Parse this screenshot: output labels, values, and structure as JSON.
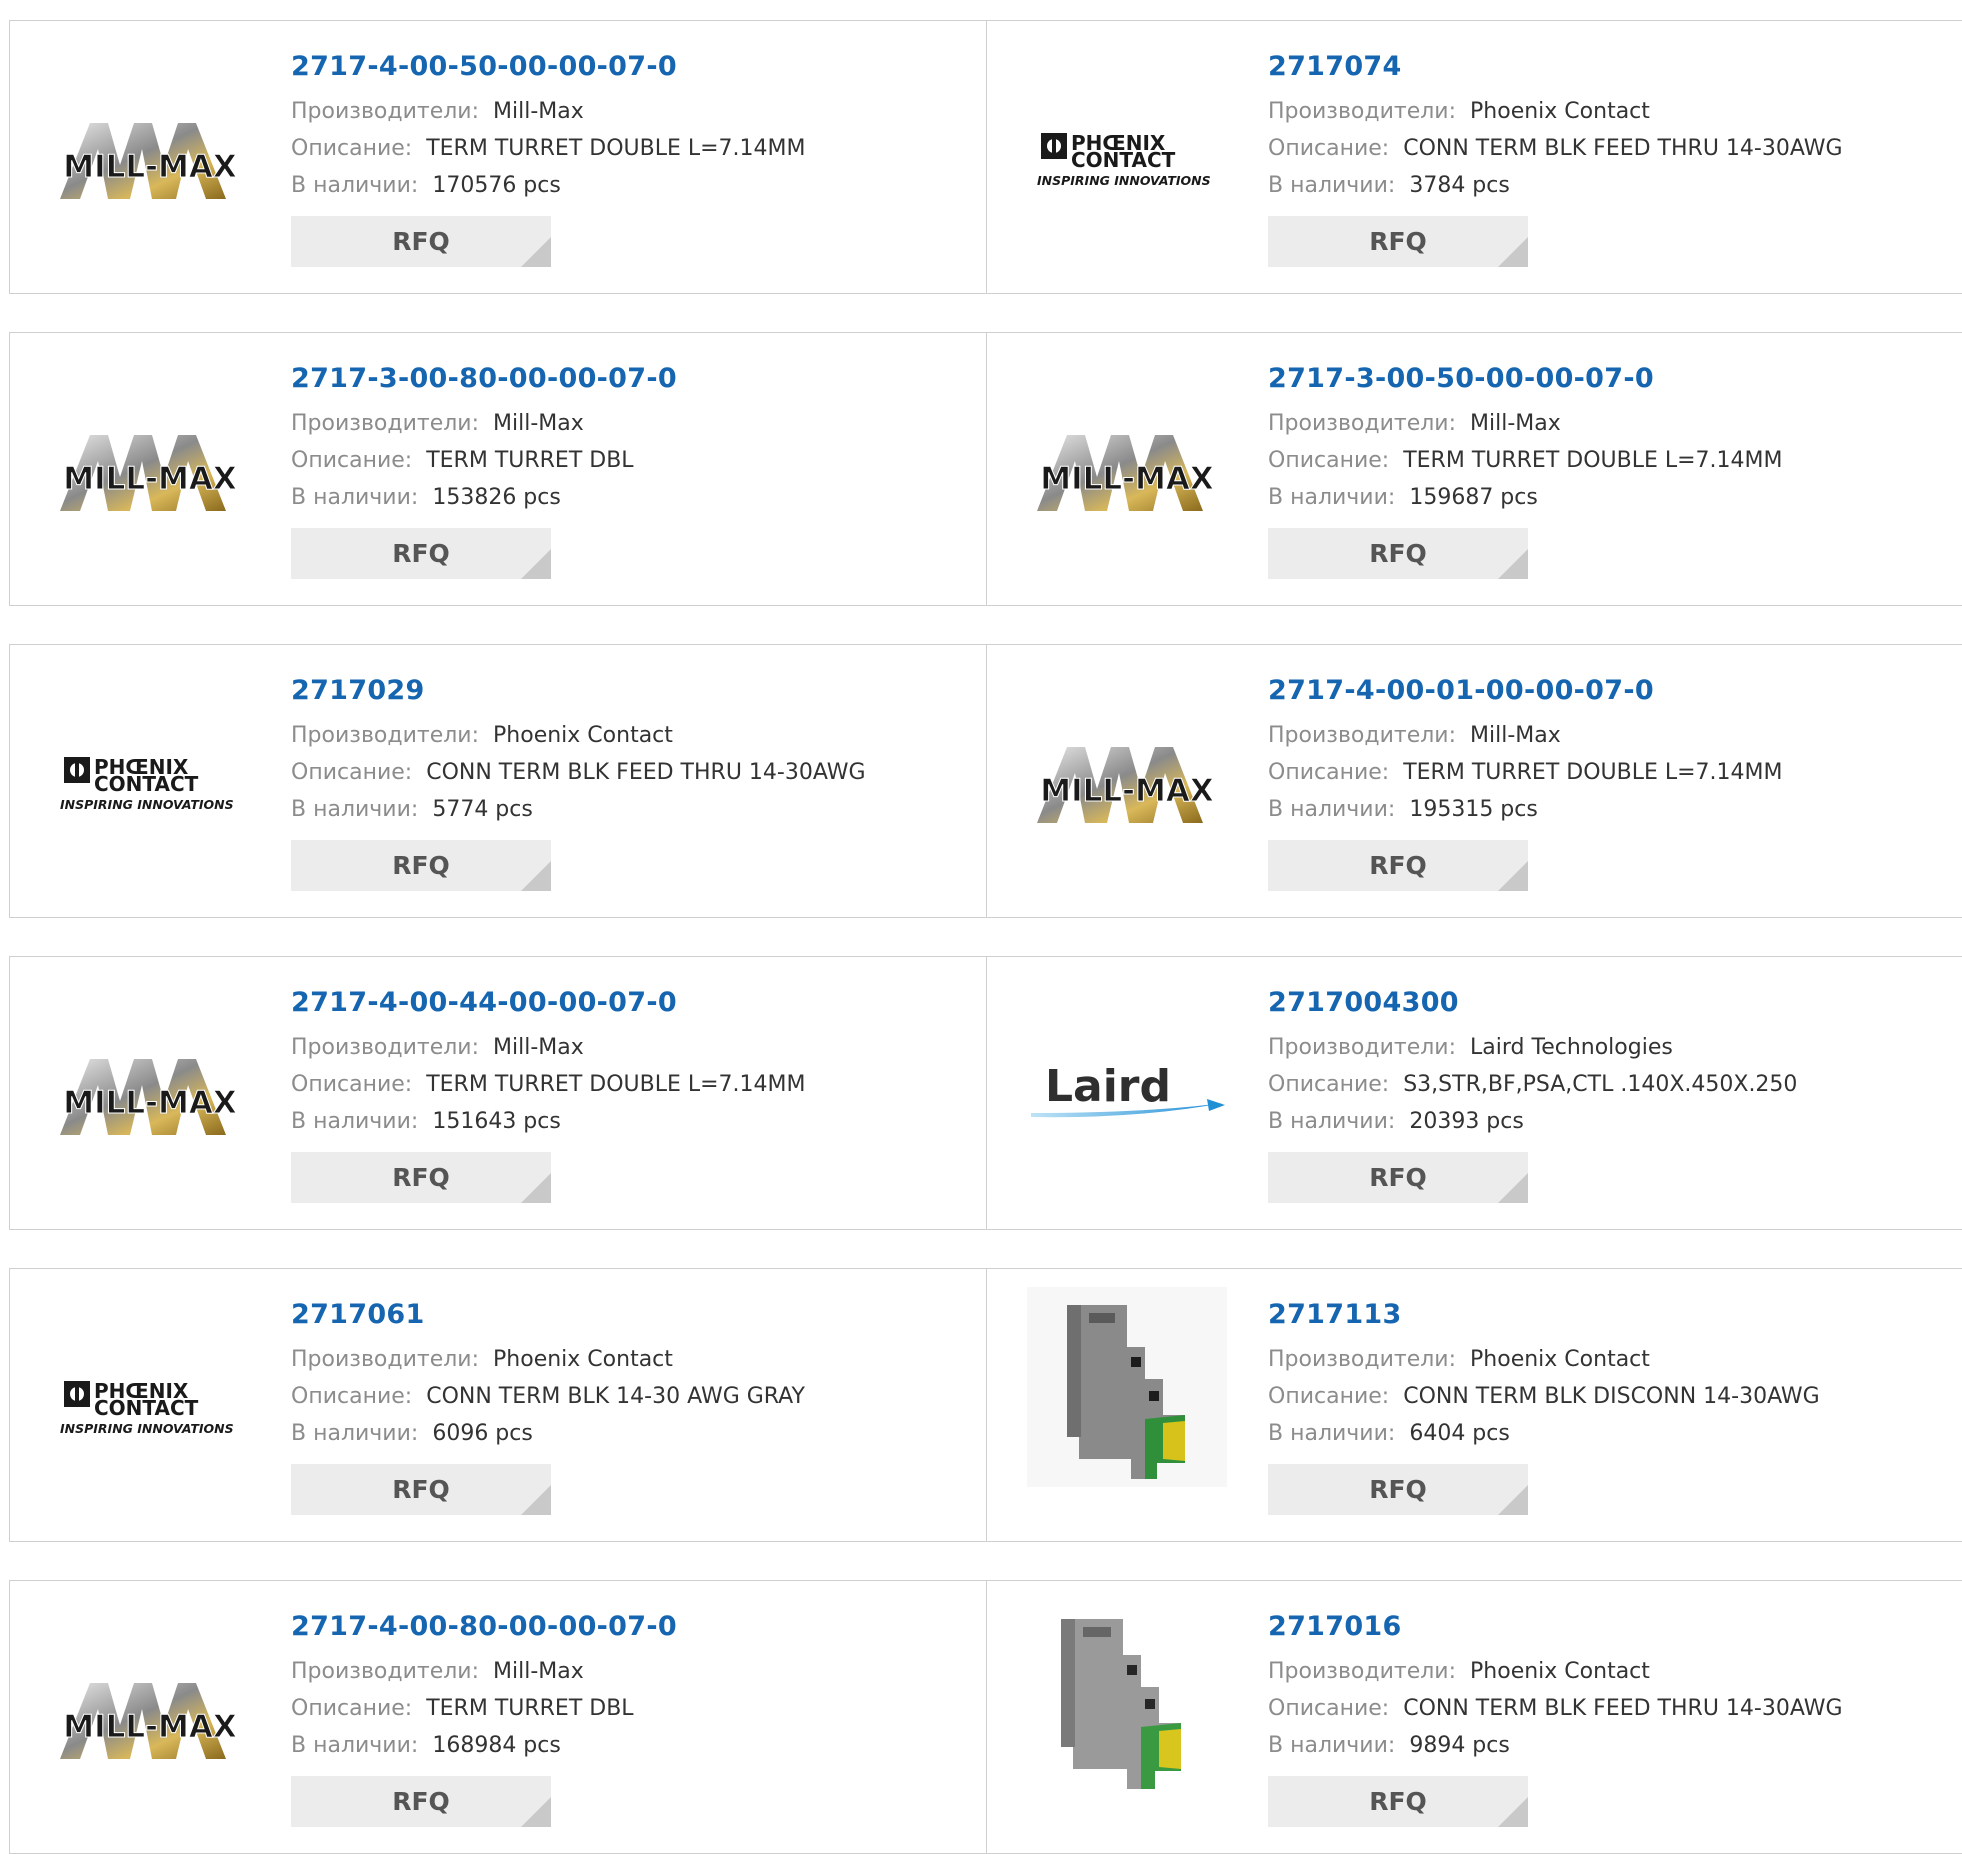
{
  "labels": {
    "manufacturer": "Производители:",
    "description": "Описание:",
    "stock": "В наличии:",
    "rfq": "RFQ"
  },
  "colors": {
    "part_link": "#1565b0",
    "label_gray": "#8c8c8c",
    "rfq_bg": "#ececec"
  },
  "brand_logos": {
    "mill_max": {
      "text": "MILL-MAX",
      "icon": "mill-max-logo"
    },
    "phoenix": {
      "line1": "PHŒNIX",
      "line2": "CONTACT",
      "tagline": "INSPIRING INNOVATIONS",
      "icon": "phoenix-contact-logo"
    },
    "laird": {
      "text": "Laird",
      "icon": "laird-logo"
    }
  },
  "products": [
    {
      "part": "2717-4-00-50-00-00-07-0",
      "manufacturer": "Mill-Max",
      "description": "TERM TURRET DOUBLE L=7.14MM",
      "stock": "170576 pcs",
      "logo": "mill-max"
    },
    {
      "part": "2717074",
      "manufacturer": "Phoenix Contact",
      "description": "CONN TERM BLK FEED THRU 14-30AWG",
      "stock": "3784 pcs",
      "logo": "phoenix"
    },
    {
      "part": "2717-3-00-80-00-00-07-0",
      "manufacturer": "Mill-Max",
      "description": "TERM TURRET DBL",
      "stock": "153826 pcs",
      "logo": "mill-max"
    },
    {
      "part": "2717-3-00-50-00-00-07-0",
      "manufacturer": "Mill-Max",
      "description": "TERM TURRET DOUBLE L=7.14MM",
      "stock": "159687 pcs",
      "logo": "mill-max"
    },
    {
      "part": "2717029",
      "manufacturer": "Phoenix Contact",
      "description": "CONN TERM BLK FEED THRU 14-30AWG",
      "stock": "5774 pcs",
      "logo": "phoenix"
    },
    {
      "part": "2717-4-00-01-00-00-07-0",
      "manufacturer": "Mill-Max",
      "description": "TERM TURRET DOUBLE L=7.14MM",
      "stock": "195315 pcs",
      "logo": "mill-max"
    },
    {
      "part": "2717-4-00-44-00-00-07-0",
      "manufacturer": "Mill-Max",
      "description": "TERM TURRET DOUBLE L=7.14MM",
      "stock": "151643 pcs",
      "logo": "mill-max"
    },
    {
      "part": "2717004300",
      "manufacturer": "Laird Technologies",
      "description": "S3,STR,BF,PSA,CTL .140X.450X.250",
      "stock": "20393 pcs",
      "logo": "laird"
    },
    {
      "part": "2717061",
      "manufacturer": "Phoenix Contact",
      "description": "CONN TERM BLK 14-30 AWG GRAY",
      "stock": "6096 pcs",
      "logo": "phoenix"
    },
    {
      "part": "2717113",
      "manufacturer": "Phoenix Contact",
      "description": "CONN TERM BLK DISCONN 14-30AWG",
      "stock": "6404 pcs",
      "logo": "terminal-block-photo"
    },
    {
      "part": "2717-4-00-80-00-00-07-0",
      "manufacturer": "Mill-Max",
      "description": "TERM TURRET DBL",
      "stock": "168984 pcs",
      "logo": "mill-max"
    },
    {
      "part": "2717016",
      "manufacturer": "Phoenix Contact",
      "description": "CONN TERM BLK FEED THRU 14-30AWG",
      "stock": "9894 pcs",
      "logo": "terminal-block-photo"
    }
  ]
}
